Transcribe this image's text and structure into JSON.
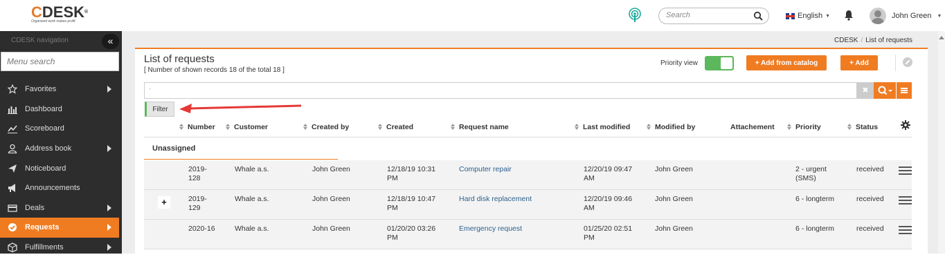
{
  "header": {
    "logo_text": "CDESK",
    "logo_tagline": "Organized work makes profit",
    "search_placeholder": "Search",
    "language": "English",
    "user_name": "John Green"
  },
  "sidebar": {
    "title": "CDESK navigation",
    "collapse_label": "«",
    "search_placeholder": "Menu search",
    "items": [
      {
        "label": "Favorites",
        "icon": "star-icon",
        "has_submenu": true
      },
      {
        "label": "Dashboard",
        "icon": "bar-chart-icon",
        "has_submenu": false
      },
      {
        "label": "Scoreboard",
        "icon": "line-chart-icon",
        "has_submenu": false
      },
      {
        "label": "Address book",
        "icon": "user-icon",
        "has_submenu": true
      },
      {
        "label": "Noticeboard",
        "icon": "paper-plane-icon",
        "has_submenu": false
      },
      {
        "label": "Announcements",
        "icon": "megaphone-icon",
        "has_submenu": false
      },
      {
        "label": "Deals",
        "icon": "card-icon",
        "has_submenu": true
      },
      {
        "label": "Requests",
        "icon": "check-circle-icon",
        "has_submenu": true,
        "active": true
      },
      {
        "label": "Fulfillments",
        "icon": "box-icon",
        "has_submenu": true
      }
    ]
  },
  "breadcrumb": {
    "root": "CDESK",
    "current": "List of requests"
  },
  "page": {
    "title": "List of requests",
    "subtitle": "[ Number of shown records 18 of the total 18 ]",
    "priority_view_label": "Priority view",
    "priority_view_on": true,
    "add_from_catalog_label": "+ Add from catalog",
    "add_label": "+ Add",
    "filter_value": "·",
    "filter_button_label": "Filter"
  },
  "table": {
    "columns": [
      "Number",
      "Customer",
      "Created by",
      "Created",
      "Request name",
      "Last modified",
      "Modified by",
      "Attachement",
      "Priority",
      "Status"
    ],
    "group_label": "Unassigned",
    "rows": [
      {
        "expand": "",
        "number": "2019-\n128",
        "customer": "Whale a.s.",
        "created_by": "John Green",
        "created": "12/18/19 10:31\nPM",
        "request_name": "Computer repair",
        "last_modified": "12/20/19 09:47\nAM",
        "modified_by": "John Green",
        "attachment": "",
        "priority": "2 - urgent\n(SMS)",
        "status": "received"
      },
      {
        "expand": "+",
        "number": "2019-\n129",
        "customer": "Whale a.s.",
        "created_by": "John Green",
        "created": "12/18/19 10:47\nPM",
        "request_name": "Hard disk replacement",
        "last_modified": "12/20/19 09:46\nAM",
        "modified_by": "John Green",
        "attachment": "",
        "priority": "6 - longterm",
        "status": "received"
      },
      {
        "expand": "",
        "number": "2020-16",
        "customer": "Whale a.s.",
        "created_by": "John Green",
        "created": "01/20/20 03:26\nPM",
        "request_name": "Emergency request",
        "last_modified": "01/25/20 02:51\nPM",
        "modified_by": "John Green",
        "attachment": "",
        "priority": "6 - longterm",
        "status": "received"
      }
    ]
  },
  "colors": {
    "accent": "#f07c22",
    "toggle": "#5cb85c",
    "link": "#2c5f8d",
    "sidebar": "#2d2d2d",
    "podcast": "#1aa89a"
  }
}
